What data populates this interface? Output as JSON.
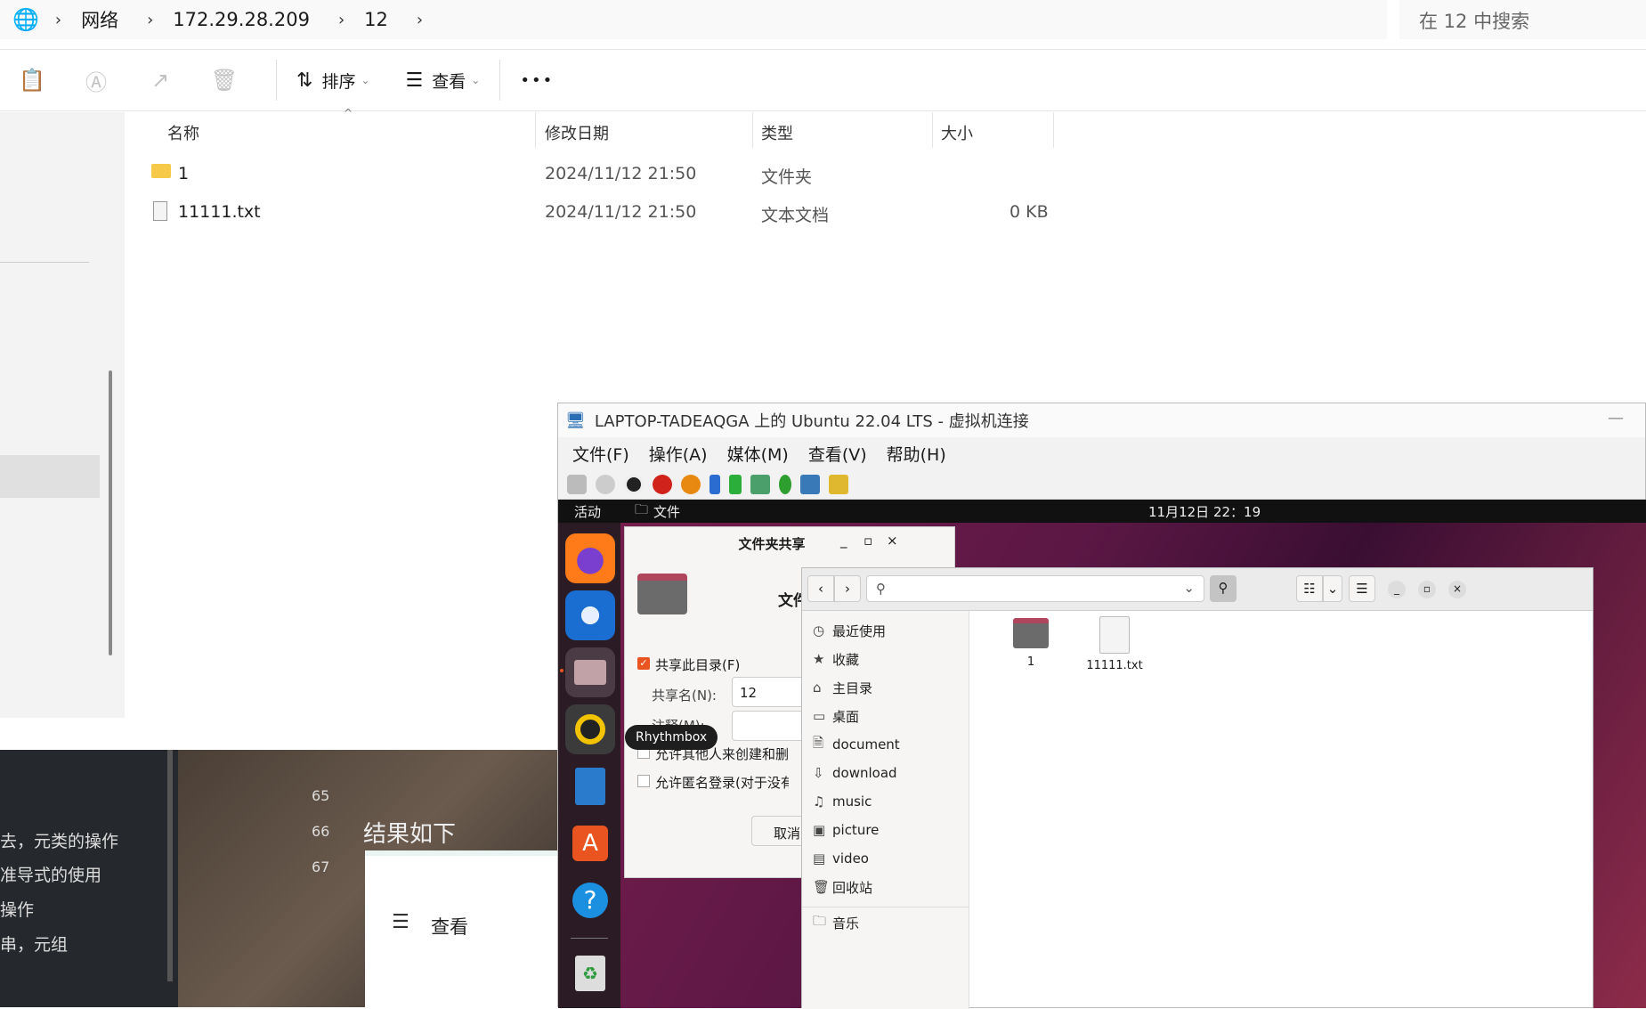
{
  "explorer": {
    "breadcrumb": [
      "网络",
      "172.29.28.209",
      "12"
    ],
    "search_placeholder": "在 12 中搜索",
    "toolbar": {
      "sort_label": "排序",
      "view_label": "查看",
      "more": "•••"
    },
    "columns": {
      "name": "名称",
      "date": "修改日期",
      "type": "类型",
      "size": "大小"
    },
    "files": [
      {
        "name": "1",
        "date": "2024/11/12 21:50",
        "type": "文件夹",
        "size": ""
      },
      {
        "name": "11111.txt",
        "date": "2024/11/12 21:50",
        "type": "文本文档",
        "size": "0 KB"
      }
    ]
  },
  "background": {
    "line_numbers": [
      "65",
      "66",
      "67"
    ],
    "lines": [
      "去，元类的操作",
      "准导式的使用",
      "操作",
      "串，元组"
    ],
    "heading": "结果如下",
    "view_label": "查看"
  },
  "vm": {
    "title": "LAPTOP-TADEAQGA 上的 Ubuntu 22.04 LTS - 虚拟机连接",
    "menu": [
      "文件(F)",
      "操作(A)",
      "媒体(M)",
      "查看(V)",
      "帮助(H)"
    ],
    "topbar": {
      "activities": "活动",
      "app": "文件",
      "clock": "11月12日  22：19"
    },
    "tooltip": "Rhythmbox",
    "share_dialog": {
      "title": "文件夹共享",
      "heading": "文件",
      "share_check": "共享此目录(F)",
      "share_name_label": "共享名(N):",
      "share_name_value": "12",
      "comment_label": "注释(M):",
      "allow_others": "允许其他人来创建和删除",
      "allow_guest": "允许匿名登录(对于没有帐",
      "cancel": "取消"
    },
    "nautilus": {
      "sidebar": [
        {
          "icon": "clock-icon",
          "label": "最近使用"
        },
        {
          "icon": "star-icon",
          "label": "收藏"
        },
        {
          "icon": "home-icon",
          "label": "主目录"
        },
        {
          "icon": "desktop-icon",
          "label": "桌面"
        },
        {
          "icon": "document-icon",
          "label": "document"
        },
        {
          "icon": "download-icon",
          "label": "download"
        },
        {
          "icon": "music-icon",
          "label": "music"
        },
        {
          "icon": "picture-icon",
          "label": "picture"
        },
        {
          "icon": "video-icon",
          "label": "video"
        },
        {
          "icon": "trash-icon",
          "label": "回收站"
        },
        {
          "icon": "folder-icon",
          "label": "音乐"
        }
      ],
      "items": [
        {
          "name": "1"
        },
        {
          "name": "11111.txt"
        }
      ]
    }
  }
}
